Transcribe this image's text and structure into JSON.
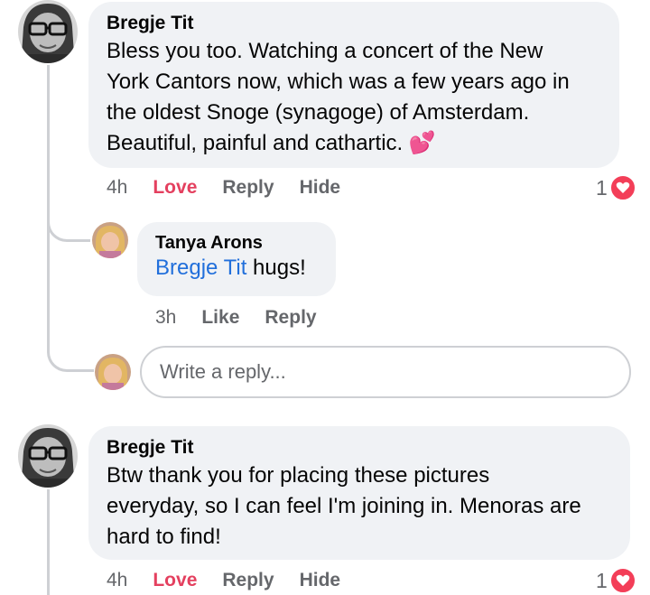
{
  "comments": [
    {
      "author": "Bregje Tit",
      "lines": [
        "Bless you too. Watching a concert of the New",
        "York Cantors now, which was a few years ago in",
        "the oldest Snoge (synagoge) of Amsterdam.",
        "Beautiful, painful and cathartic."
      ],
      "emoji": "💕",
      "time": "4h",
      "love_label": "Love",
      "reply_label": "Reply",
      "hide_label": "Hide",
      "reaction_count": "1"
    },
    {
      "author": "Tanya Arons",
      "mention": "Bregje Tit",
      "text": " hugs!",
      "time": "3h",
      "like_label": "Like",
      "reply_label": "Reply"
    },
    {
      "author": "Bregje Tit",
      "lines": [
        "Btw thank you for placing these pictures",
        "everyday, so I can feel I'm joining in. Menoras are",
        "hard to find!"
      ],
      "time": "4h",
      "love_label": "Love",
      "reply_label": "Reply",
      "hide_label": "Hide",
      "reaction_count": "1"
    }
  ],
  "reply_box": {
    "placeholder": "Write a reply..."
  },
  "colors": {
    "bubble": "#f0f2f5",
    "love": "#e4405f",
    "mention": "#216fdb",
    "muted": "#65676b",
    "heart": "#f33e58"
  }
}
